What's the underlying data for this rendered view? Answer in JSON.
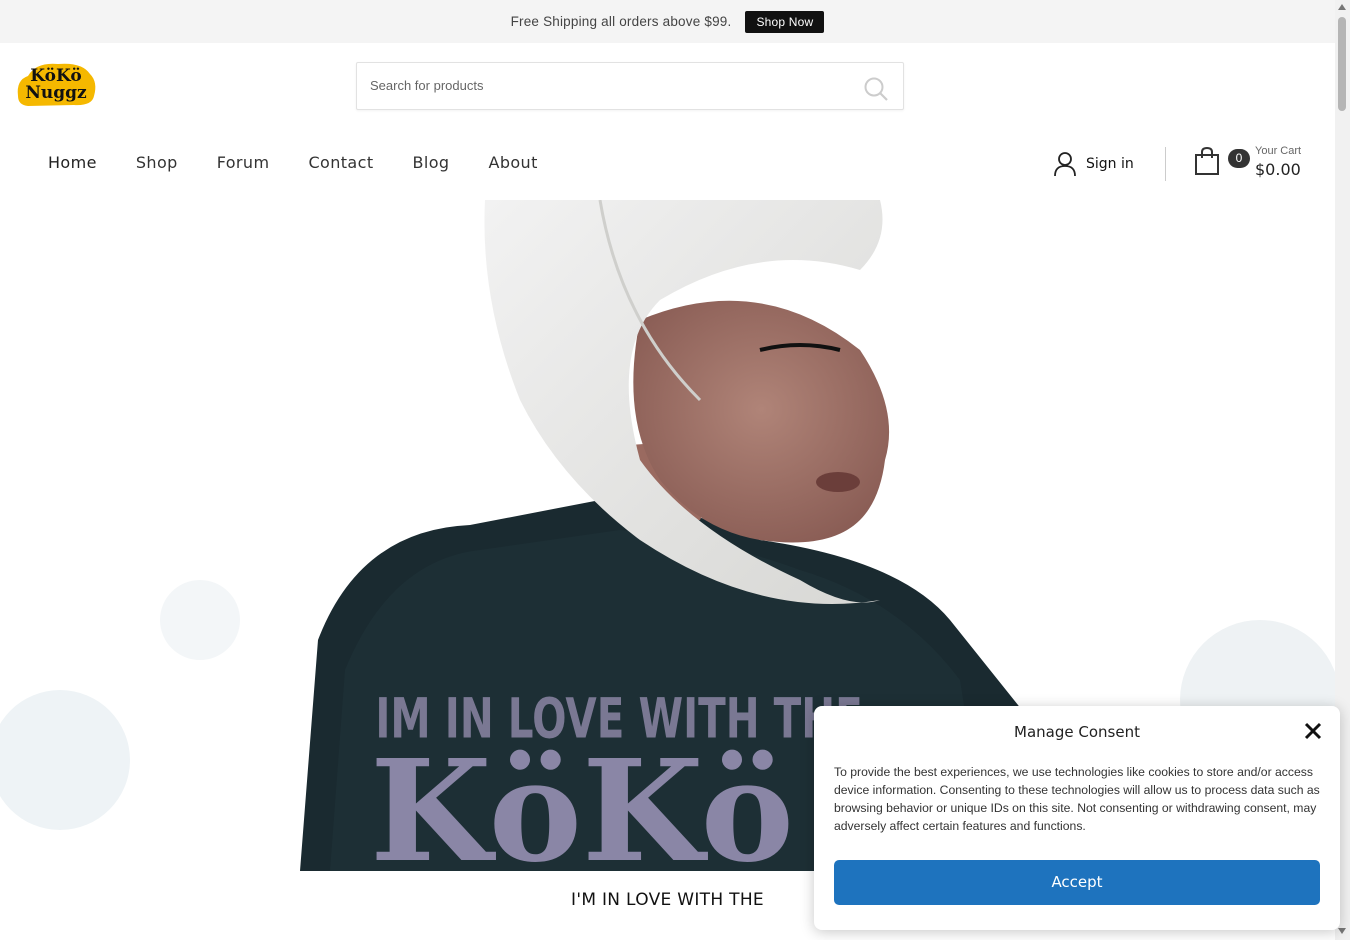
{
  "promo": {
    "text": "Free Shipping all orders above $99.",
    "button": "Shop Now"
  },
  "logo": {
    "alt": "KoKo Nuggz",
    "line1": "KöKö",
    "line2": "Nuggz"
  },
  "search": {
    "placeholder": "Search for products",
    "icon": "search-icon"
  },
  "nav": {
    "items": [
      "Home",
      "Shop",
      "Forum",
      "Contact",
      "Blog",
      "About"
    ],
    "active": "Home"
  },
  "account": {
    "label": "Sign in",
    "icon": "user-icon"
  },
  "cart": {
    "count": "0",
    "label": "Your Cart",
    "total": "$0.00",
    "icon": "shopping-bag-icon"
  },
  "hero": {
    "shirt_line1": "IM IN LOVE WITH THE",
    "shirt_line2": "KöKö",
    "caption": "I'M IN LOVE WITH THE"
  },
  "consent": {
    "title": "Manage Consent",
    "body": "To provide the best experiences, we use technologies like cookies to store and/or access device information. Consenting to these technologies will allow us to process data such as browsing behavior or unique IDs on this site. Not consenting or withdrawing consent, may adversely affect certain features and functions.",
    "accept": "Accept",
    "accent": "#1e73be"
  }
}
